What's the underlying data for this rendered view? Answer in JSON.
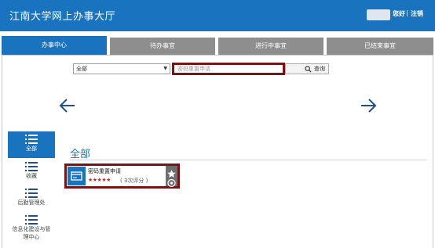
{
  "header": {
    "title": "江南大学网上办事大厅",
    "greeting": "您好",
    "separator": "|",
    "logout_label": "注销"
  },
  "tabs": [
    {
      "label": "办事中心"
    },
    {
      "label": "待办事宜"
    },
    {
      "label": "进行中事宜"
    },
    {
      "label": "已结束事宜"
    }
  ],
  "search": {
    "category_selected": "全部",
    "input_value": "密码重置申请",
    "button_label": "查询"
  },
  "nav_arrows": {
    "prev_icon": "arrow-left-icon",
    "next_icon": "arrow-right-icon"
  },
  "sidebar": {
    "items": [
      {
        "label": "全部",
        "icon": "list-icon"
      },
      {
        "label": "收藏",
        "icon": "list-icon"
      },
      {
        "label": "后勤管理处",
        "icon": "list-icon"
      },
      {
        "label": "信息化建设与管理中心",
        "icon": "list-icon"
      }
    ]
  },
  "main": {
    "heading": "全部",
    "services": [
      {
        "name": "密码重置申请",
        "stars": "★★★★★",
        "rating_text": "( 3次评分 )",
        "icon": "card-icon"
      }
    ]
  },
  "colors": {
    "brand_blue": "#1a73bf",
    "tab_gray": "#8e8e8e",
    "highlight_red": "#7a1414",
    "star_red": "#d0262b"
  }
}
